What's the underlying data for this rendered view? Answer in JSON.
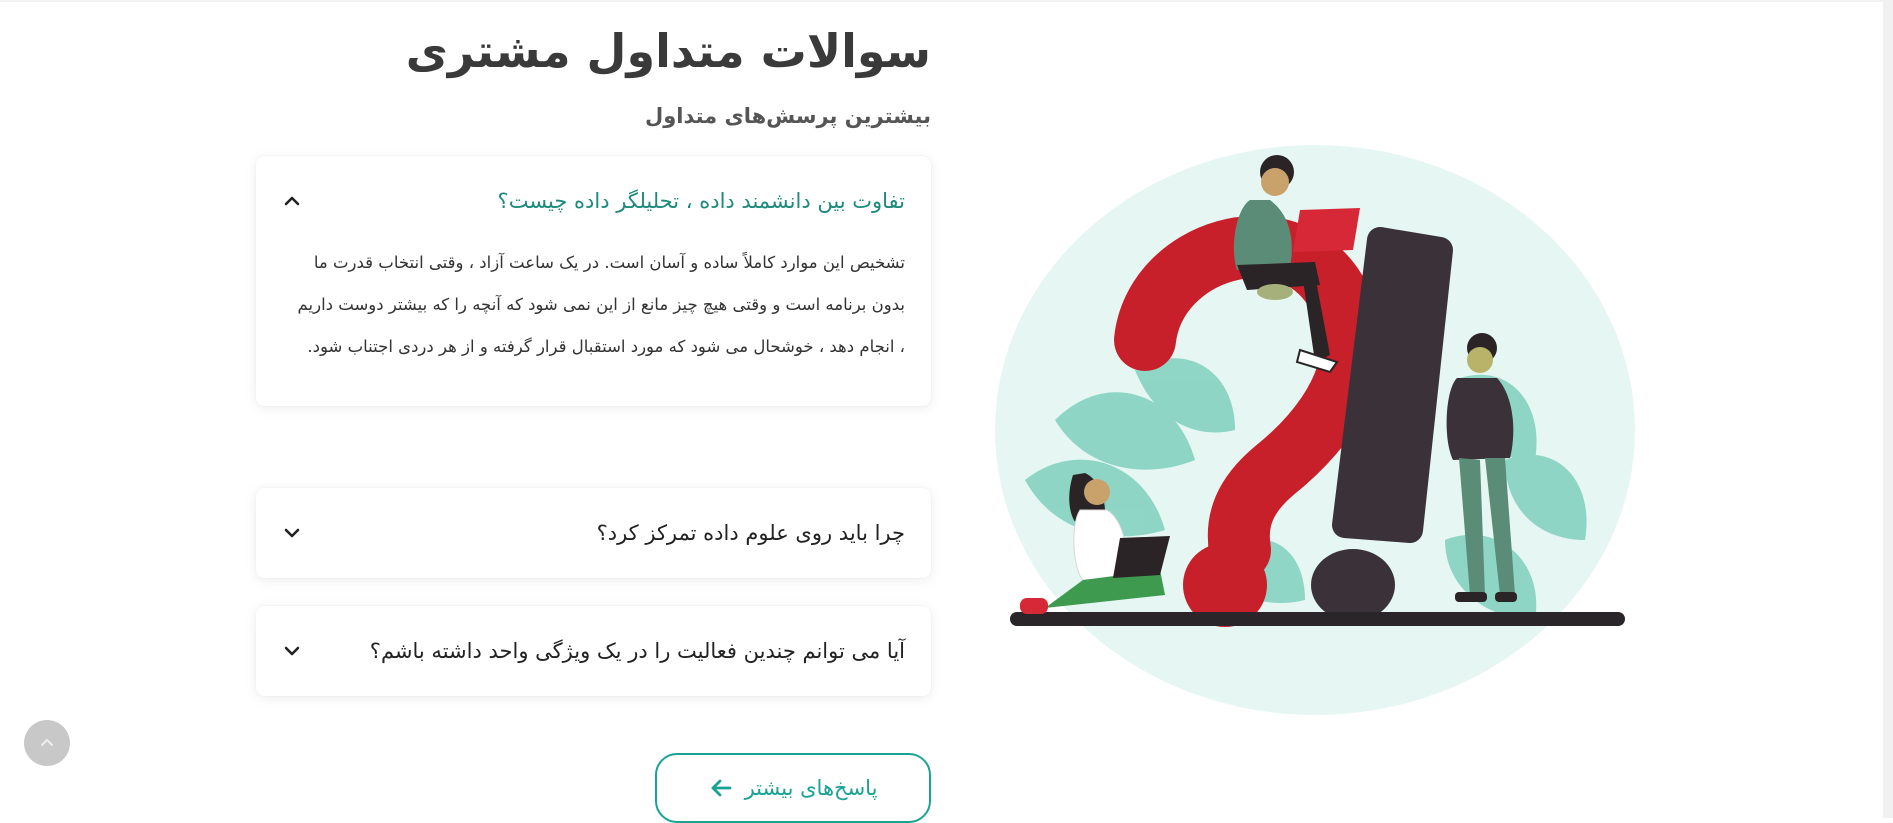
{
  "header": {
    "title": "سوالات متداول مشتری",
    "subtitle": "بیشترین پرسش‌های متداول"
  },
  "faq": {
    "items": [
      {
        "question": "تفاوت بین دانشمند داده ، تحلیلگر داده چیست؟",
        "answer": "تشخیص این موارد کاملاً ساده و آسان است. در یک ساعت آزاد ، وقتی انتخاب قدرت ما بدون برنامه است و وقتی هیچ چیز مانع از این نمی شود که آنچه را که بیشتر دوست داریم ، انجام دهد ، خوشحال می شود که مورد استقبال قرار گرفته و از هر دردی اجتناب شود.",
        "expanded": true
      },
      {
        "question": "چرا باید روی علوم داده تمرکز کرد؟",
        "expanded": false
      },
      {
        "question": "آیا می توانم چندین فعالیت را در یک ویژگی واحد داشته باشم؟",
        "expanded": false
      }
    ]
  },
  "more_button": {
    "label": "پاسخ‌های بیشتر",
    "icon": "arrow-left-icon"
  },
  "back_to_top": {
    "icon": "chevron-up-icon"
  },
  "illustration": {
    "label": "question-mark-illustration"
  },
  "colors": {
    "accent": "#1aa394",
    "question_active": "#1d8a7c",
    "red": "#c8202b",
    "dark": "#3a3238",
    "mint": "#e6f6f2"
  }
}
